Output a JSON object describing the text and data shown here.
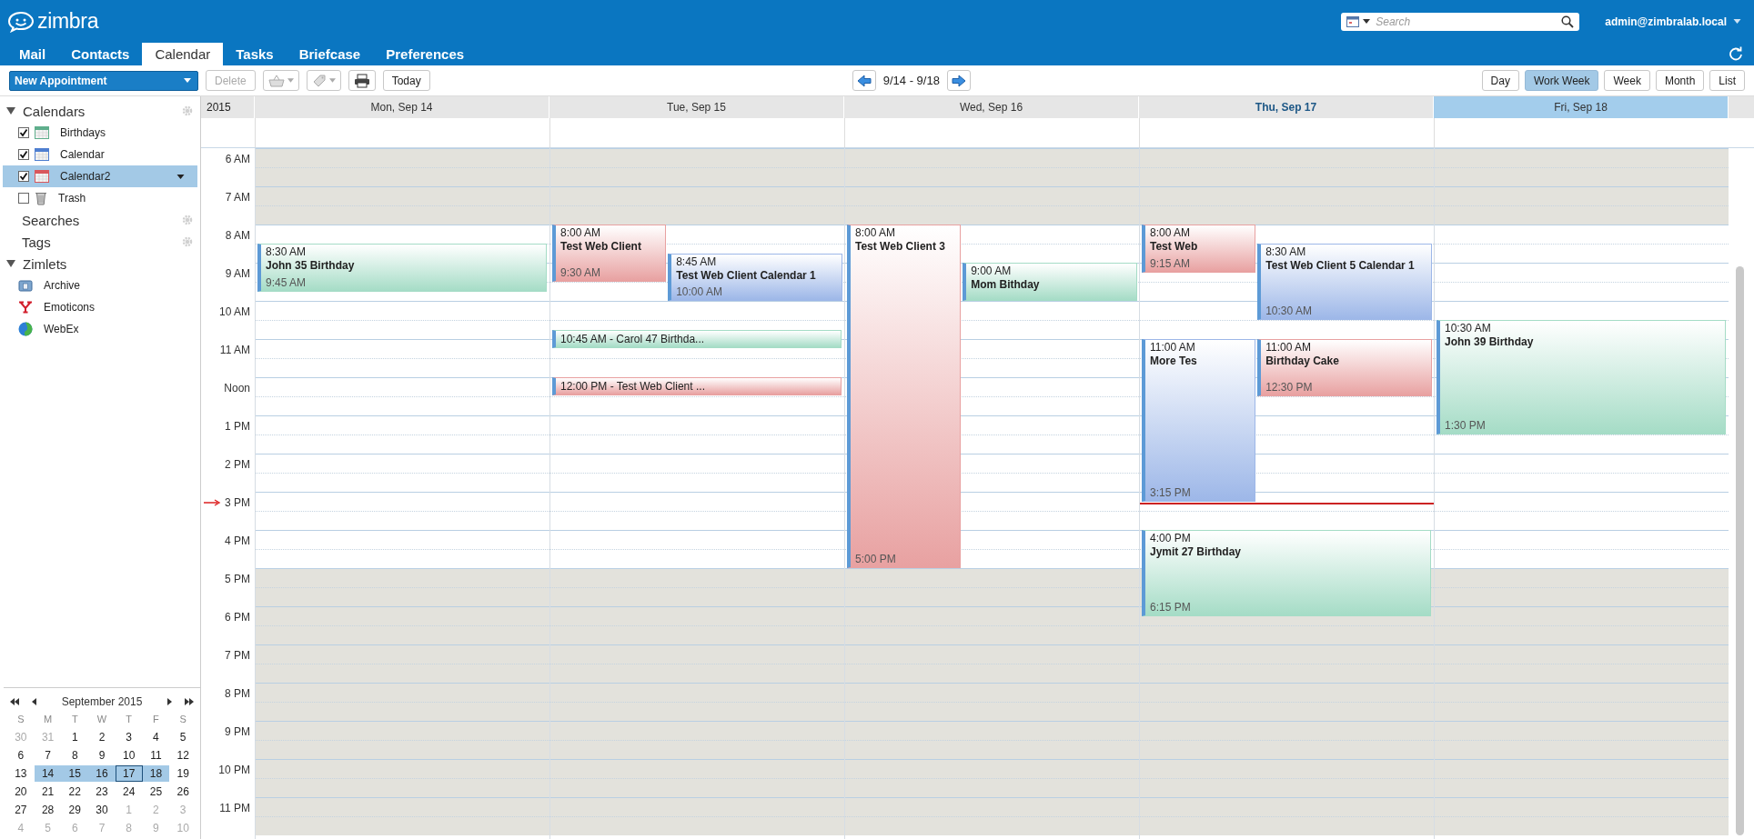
{
  "header": {
    "logo": "zimbra",
    "search": {
      "placeholder": "Search"
    },
    "user": "admin@zimbralab.local"
  },
  "tabs": [
    {
      "label": "Mail",
      "selected": false
    },
    {
      "label": "Contacts",
      "selected": false
    },
    {
      "label": "Calendar",
      "selected": true
    },
    {
      "label": "Tasks",
      "selected": false
    },
    {
      "label": "Briefcase",
      "selected": false
    },
    {
      "label": "Preferences",
      "selected": false
    }
  ],
  "toolbar": {
    "new_button": "New Appointment",
    "delete_button": {
      "label": "Delete",
      "disabled": true
    },
    "today_button": "Today",
    "range": "9/14 - 9/18",
    "views": [
      {
        "label": "Day",
        "selected": false
      },
      {
        "label": "Work Week",
        "selected": true
      },
      {
        "label": "Week",
        "selected": false
      },
      {
        "label": "Month",
        "selected": false
      },
      {
        "label": "List",
        "selected": false
      }
    ]
  },
  "sidebar": {
    "sections": [
      {
        "title": "Calendars",
        "expanded": true,
        "settings": true,
        "items": [
          {
            "kind": "calendar",
            "label": "Birthdays",
            "checked": true,
            "selected": false,
            "color": "#5fae8c"
          },
          {
            "kind": "calendar",
            "label": "Calendar",
            "checked": true,
            "selected": false,
            "color": "#4f7fd0"
          },
          {
            "kind": "calendar",
            "label": "Calendar2",
            "checked": true,
            "selected": true,
            "color": "#d9575c"
          },
          {
            "kind": "trash",
            "label": "Trash",
            "checked": false,
            "selected": false
          }
        ]
      },
      {
        "title": "Searches",
        "settings": true
      },
      {
        "title": "Tags",
        "settings": true
      },
      {
        "title": "Zimlets",
        "expanded": true,
        "settings": false,
        "items": [
          {
            "kind": "archive",
            "label": "Archive"
          },
          {
            "kind": "emoticons",
            "label": "Emoticons"
          },
          {
            "kind": "webex",
            "label": "WebEx"
          }
        ]
      }
    ]
  },
  "minical": {
    "title": "September 2015",
    "weekdays": [
      "S",
      "M",
      "T",
      "W",
      "T",
      "F",
      "S"
    ],
    "weeks": [
      [
        {
          "day": "30",
          "other_month": true,
          "selected": false,
          "today": false
        },
        {
          "day": "31",
          "other_month": true,
          "selected": false,
          "today": false
        },
        {
          "day": "1",
          "other_month": false,
          "selected": false,
          "today": false
        },
        {
          "day": "2",
          "other_month": false,
          "selected": false,
          "today": false
        },
        {
          "day": "3",
          "other_month": false,
          "selected": false,
          "today": false
        },
        {
          "day": "4",
          "other_month": false,
          "selected": false,
          "today": false
        },
        {
          "day": "5",
          "other_month": false,
          "selected": false,
          "today": false
        }
      ],
      [
        {
          "day": "6",
          "other_month": false,
          "selected": false,
          "today": false
        },
        {
          "day": "7",
          "other_month": false,
          "selected": false,
          "today": false
        },
        {
          "day": "8",
          "other_month": false,
          "selected": false,
          "today": false
        },
        {
          "day": "9",
          "other_month": false,
          "selected": false,
          "today": false
        },
        {
          "day": "10",
          "other_month": false,
          "selected": false,
          "today": false
        },
        {
          "day": "11",
          "other_month": false,
          "selected": false,
          "today": false
        },
        {
          "day": "12",
          "other_month": false,
          "selected": false,
          "today": false
        }
      ],
      [
        {
          "day": "13",
          "other_month": false,
          "selected": false,
          "today": false
        },
        {
          "day": "14",
          "other_month": false,
          "selected": true,
          "today": false
        },
        {
          "day": "15",
          "other_month": false,
          "selected": true,
          "today": false
        },
        {
          "day": "16",
          "other_month": false,
          "selected": true,
          "today": false
        },
        {
          "day": "17",
          "other_month": false,
          "selected": true,
          "today": true
        },
        {
          "day": "18",
          "other_month": false,
          "selected": true,
          "today": false
        },
        {
          "day": "19",
          "other_month": false,
          "selected": false,
          "today": false
        }
      ],
      [
        {
          "day": "20",
          "other_month": false,
          "selected": false,
          "today": false
        },
        {
          "day": "21",
          "other_month": false,
          "selected": false,
          "today": false
        },
        {
          "day": "22",
          "other_month": false,
          "selected": false,
          "today": false
        },
        {
          "day": "23",
          "other_month": false,
          "selected": false,
          "today": false
        },
        {
          "day": "24",
          "other_month": false,
          "selected": false,
          "today": false
        },
        {
          "day": "25",
          "other_month": false,
          "selected": false,
          "today": false
        },
        {
          "day": "26",
          "other_month": false,
          "selected": false,
          "today": false
        }
      ],
      [
        {
          "day": "27",
          "other_month": false,
          "selected": false,
          "today": false
        },
        {
          "day": "28",
          "other_month": false,
          "selected": false,
          "today": false
        },
        {
          "day": "29",
          "other_month": false,
          "selected": false,
          "today": false
        },
        {
          "day": "30",
          "other_month": false,
          "selected": false,
          "today": false
        },
        {
          "day": "1",
          "other_month": true,
          "selected": false,
          "today": false
        },
        {
          "day": "2",
          "other_month": true,
          "selected": false,
          "today": false
        },
        {
          "day": "3",
          "other_month": true,
          "selected": false,
          "today": false
        }
      ],
      [
        {
          "day": "4",
          "other_month": true,
          "selected": false,
          "today": false
        },
        {
          "day": "5",
          "other_month": true,
          "selected": false,
          "today": false
        },
        {
          "day": "6",
          "other_month": true,
          "selected": false,
          "today": false
        },
        {
          "day": "7",
          "other_month": true,
          "selected": false,
          "today": false
        },
        {
          "day": "8",
          "other_month": true,
          "selected": false,
          "today": false
        },
        {
          "day": "9",
          "other_month": true,
          "selected": false,
          "today": false
        },
        {
          "day": "10",
          "other_month": true,
          "selected": false,
          "today": false
        }
      ]
    ]
  },
  "grid": {
    "year": "2015",
    "hours": [
      {
        "label": "6 AM",
        "working": false,
        "now": false
      },
      {
        "label": "7 AM",
        "working": false,
        "now": false
      },
      {
        "label": "8 AM",
        "working": true,
        "now": false
      },
      {
        "label": "9 AM",
        "working": true,
        "now": false
      },
      {
        "label": "10 AM",
        "working": true,
        "now": false
      },
      {
        "label": "11 AM",
        "working": true,
        "now": false
      },
      {
        "label": "Noon",
        "working": true,
        "now": false
      },
      {
        "label": "1 PM",
        "working": true,
        "now": false
      },
      {
        "label": "2 PM",
        "working": true,
        "now": false
      },
      {
        "label": "3 PM",
        "working": true,
        "now": true
      },
      {
        "label": "4 PM",
        "working": true,
        "now": false
      },
      {
        "label": "5 PM",
        "working": false,
        "now": false
      },
      {
        "label": "6 PM",
        "working": false,
        "now": false
      },
      {
        "label": "7 PM",
        "working": false,
        "now": false
      },
      {
        "label": "8 PM",
        "working": false,
        "now": false
      },
      {
        "label": "9 PM",
        "working": false,
        "now": false
      },
      {
        "label": "10 PM",
        "working": false,
        "now": false
      },
      {
        "label": "11 PM",
        "working": false,
        "now": false
      }
    ],
    "days": [
      {
        "label": "Mon, Sep 14",
        "today": false,
        "selected": false,
        "events": [
          {
            "kind": "block",
            "color": "#a5dcc6",
            "start": "8:30 AM",
            "title": "John 35 Birthday",
            "end": "9:45 AM"
          }
        ]
      },
      {
        "label": "Tue, Sep 15",
        "today": false,
        "selected": false,
        "events": [
          {
            "kind": "block",
            "color": "#e8a1a1",
            "start": "8:00 AM",
            "title": "Test Web Client",
            "end": "9:30 AM"
          },
          {
            "kind": "block",
            "color": "#9db7e8",
            "start": "8:45 AM",
            "title": "Test Web Client Calendar 1",
            "end": "10:00 AM"
          },
          {
            "kind": "compact",
            "color": "#a5dcc6",
            "label": "10:45 AM - Carol 47 Birthda..."
          },
          {
            "kind": "compact",
            "color": "#e8a1a1",
            "label": "12:00 PM - Test Web Client ..."
          }
        ]
      },
      {
        "label": "Wed, Sep 16",
        "today": false,
        "selected": false,
        "events": [
          {
            "kind": "block",
            "color": "#e8a1a1",
            "start": "8:00 AM",
            "title": "Test Web Client 3",
            "end": "5:00 PM"
          },
          {
            "kind": "block",
            "color": "#a5dcc6",
            "start": "9:00 AM",
            "title": "Mom Bithday"
          }
        ]
      },
      {
        "label": "Thu, Sep 17",
        "today": true,
        "selected": false,
        "events": [
          {
            "kind": "block",
            "color": "#e8a1a1",
            "start": "8:00 AM",
            "title": "Test Web",
            "end": "9:15 AM"
          },
          {
            "kind": "block",
            "color": "#9db7e8",
            "start": "8:30 AM",
            "title": "Test Web Client 5 Calendar 1",
            "end": "10:30 AM"
          },
          {
            "kind": "block",
            "color": "#9db7e8",
            "start": "11:00 AM",
            "title": "More Tes",
            "end": "3:15 PM"
          },
          {
            "kind": "block",
            "color": "#e8a1a1",
            "start": "11:00 AM",
            "title": "Birthday Cake",
            "end": "12:30 PM"
          },
          {
            "kind": "block",
            "color": "#a5dcc6",
            "start": "4:00 PM",
            "title": "Jymit 27 Birthday",
            "end": "6:15 PM"
          }
        ]
      },
      {
        "label": "Fri, Sep 18",
        "today": false,
        "selected": true,
        "events": [
          {
            "kind": "block",
            "color": "#a5dcc6",
            "start": "10:30 AM",
            "title": "John 39 Birthday",
            "end": "1:30 PM"
          }
        ]
      }
    ]
  }
}
